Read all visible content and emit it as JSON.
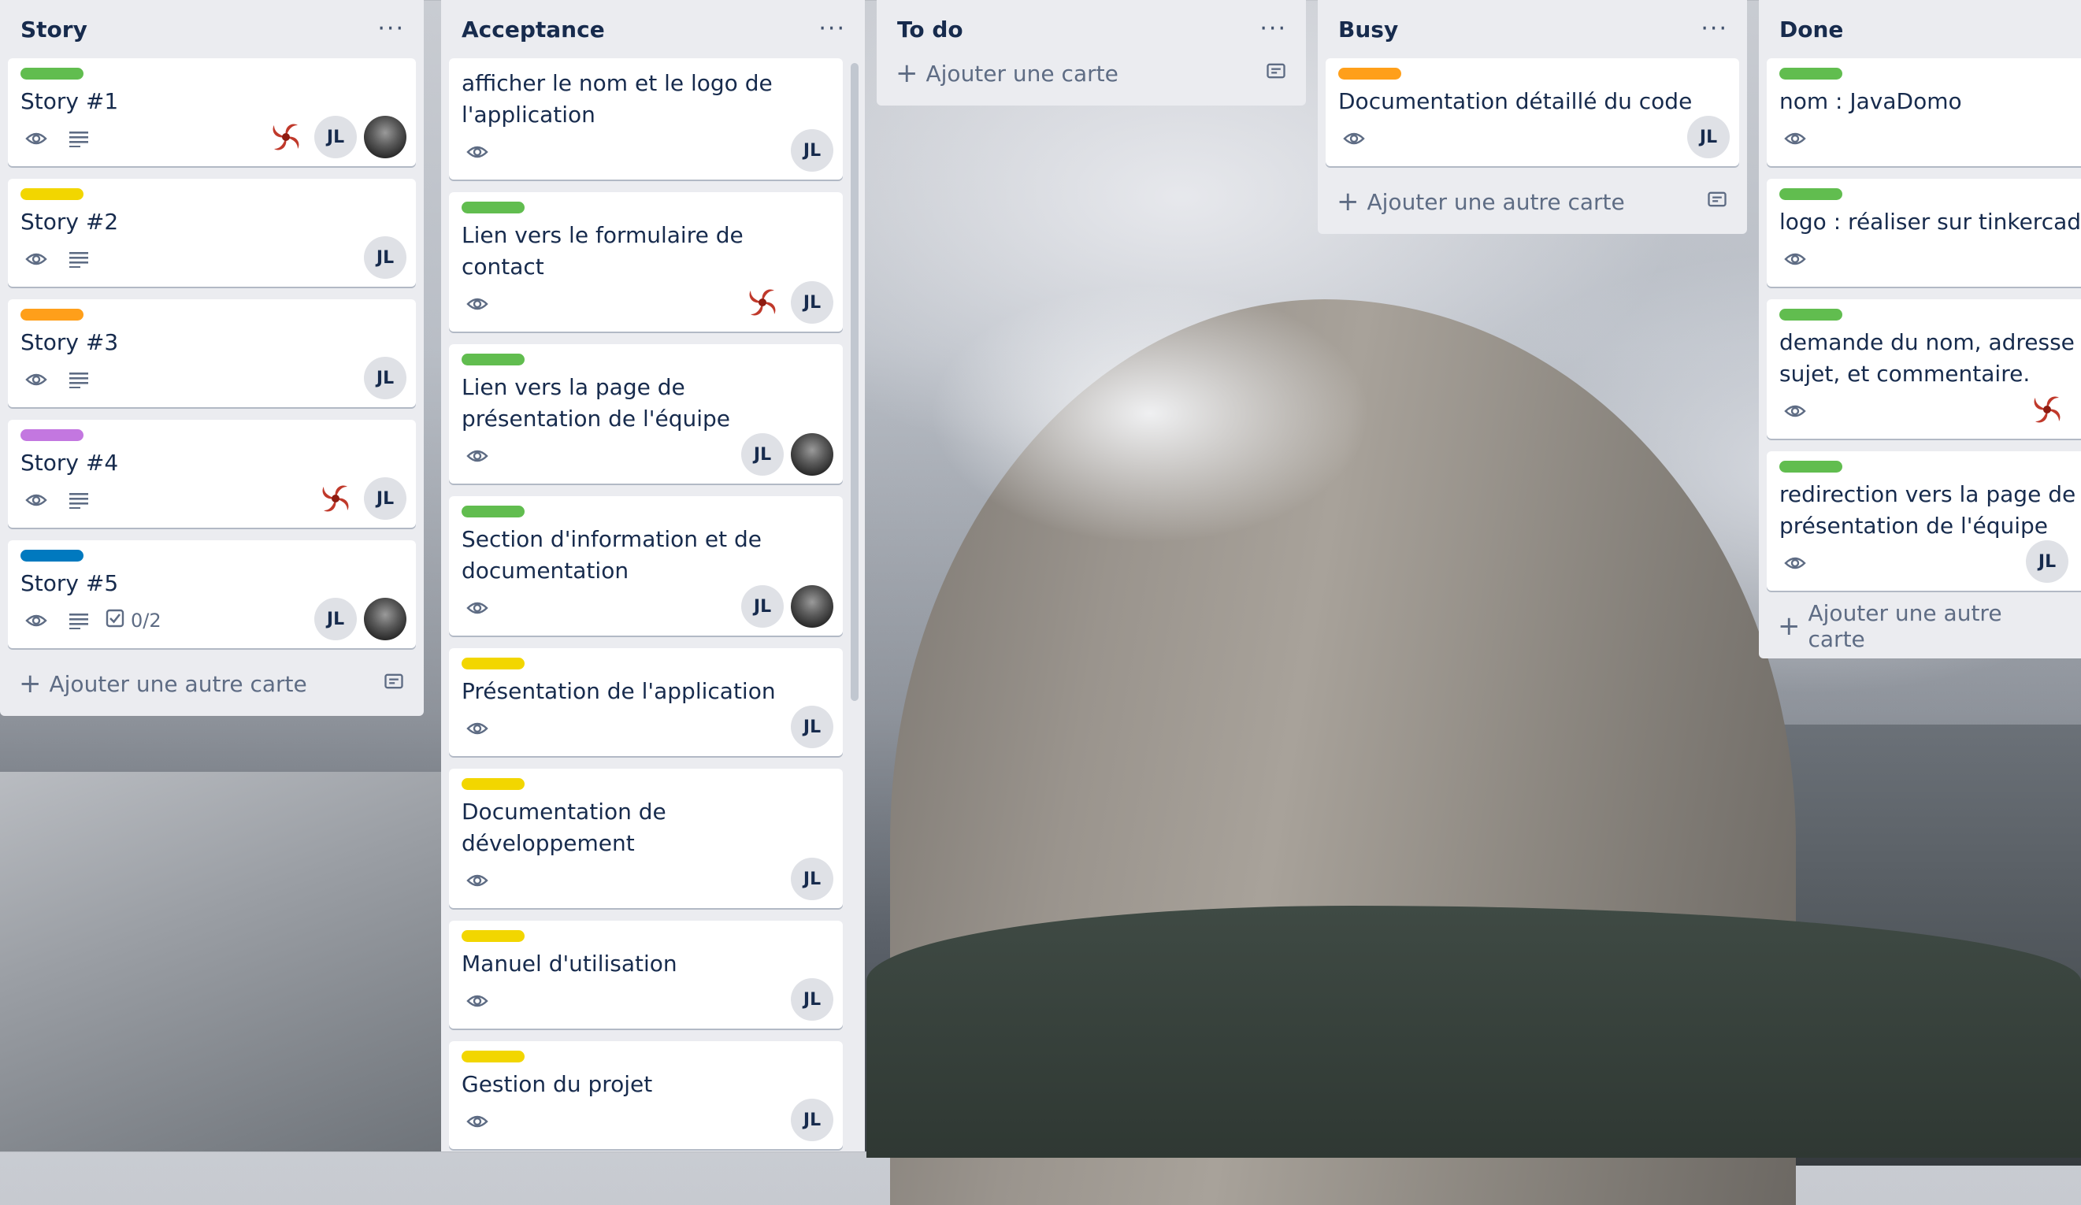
{
  "colors": {
    "green": "#61bd4f",
    "yellow": "#f2d600",
    "orange": "#ff9f1a",
    "purple": "#c377e0",
    "blue": "#0079bf"
  },
  "add_card_label": "Ajouter une autre carte",
  "todo_add_label": "Ajouter une carte",
  "lists": [
    {
      "title": "Story",
      "menu": "···",
      "cards": [
        {
          "label": "green",
          "title": "Story #1",
          "members": [
            "swirl",
            "JL",
            "photo"
          ]
        },
        {
          "label": "yellow",
          "title": "Story #2",
          "members": [
            "JL"
          ]
        },
        {
          "label": "orange",
          "title": "Story #3",
          "members": [
            "JL"
          ]
        },
        {
          "label": "purple",
          "title": "Story #4",
          "members": [
            "swirl",
            "JL"
          ]
        },
        {
          "label": "blue",
          "title": "Story #5",
          "checklist": "0/2",
          "members": [
            "JL",
            "photo"
          ]
        }
      ]
    },
    {
      "title": "Acceptance",
      "menu": "···",
      "cards": [
        {
          "title": "afficher le nom et le logo de l'application",
          "members": [
            "JL"
          ]
        },
        {
          "label": "green",
          "title": "Lien vers le formulaire de contact",
          "members": [
            "swirl",
            "JL"
          ]
        },
        {
          "label": "green",
          "title": "Lien vers la page de présentation de l'équipe",
          "members": [
            "JL",
            "photo"
          ]
        },
        {
          "label": "green",
          "title": "Section d'information et de documentation",
          "members": [
            "JL",
            "photo"
          ]
        },
        {
          "label": "yellow",
          "title": "Présentation de l'application",
          "members": [
            "JL"
          ]
        },
        {
          "label": "yellow",
          "title": "Documentation de développement",
          "members": [
            "JL"
          ]
        },
        {
          "label": "yellow",
          "title": "Manuel d'utilisation",
          "members": [
            "JL"
          ]
        },
        {
          "label": "yellow",
          "title": "Gestion du projet",
          "members": [
            "JL"
          ]
        }
      ]
    },
    {
      "title": "To do",
      "menu": "···",
      "cards": []
    },
    {
      "title": "Busy",
      "menu": "···",
      "cards": [
        {
          "label": "orange",
          "title": "Documentation détaillé du code",
          "members": [
            "JL"
          ]
        }
      ]
    },
    {
      "title": "Done",
      "menu": "",
      "cards": [
        {
          "label": "green",
          "title": "nom : JavaDomo",
          "members": []
        },
        {
          "label": "green",
          "title": "logo : réaliser sur tinkercad",
          "members": []
        },
        {
          "label": "green",
          "title": "demande du nom, adresse en sujet, et commentaire.",
          "members": [
            "swirl"
          ]
        },
        {
          "label": "green",
          "title": "redirection vers la page de présentation de l'équipe",
          "members": [
            "JL"
          ]
        }
      ]
    }
  ]
}
